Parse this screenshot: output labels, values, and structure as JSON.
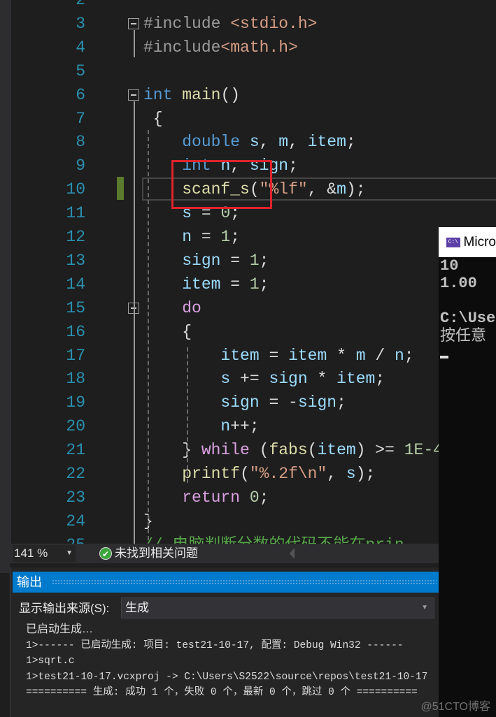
{
  "editor": {
    "lines": [
      {
        "n": "2",
        "tokens": []
      },
      {
        "n": "3",
        "tokens": [
          [
            "#include ",
            "pp"
          ],
          [
            "<stdio.h>",
            "str"
          ]
        ]
      },
      {
        "n": "4",
        "tokens": [
          [
            "#include",
            "pp"
          ],
          [
            "<math.h>",
            "str"
          ]
        ]
      },
      {
        "n": "5",
        "tokens": []
      },
      {
        "n": "6",
        "tokens": [
          [
            "int",
            "kw"
          ],
          [
            " ",
            "pl"
          ],
          [
            "main",
            "fn"
          ],
          [
            "()",
            "pl"
          ]
        ]
      },
      {
        "n": "7",
        "tokens": [
          [
            " {",
            "pl"
          ]
        ]
      },
      {
        "n": "8",
        "tokens": [
          [
            "    ",
            "pl"
          ],
          [
            "double",
            "kw"
          ],
          [
            " ",
            "pl"
          ],
          [
            "s",
            "var"
          ],
          [
            ", ",
            "pl"
          ],
          [
            "m",
            "var"
          ],
          [
            ", ",
            "pl"
          ],
          [
            "item",
            "var"
          ],
          [
            ";",
            "pl"
          ]
        ]
      },
      {
        "n": "9",
        "tokens": [
          [
            "    ",
            "pl"
          ],
          [
            "int",
            "kw"
          ],
          [
            " ",
            "pl"
          ],
          [
            "n",
            "var"
          ],
          [
            ", ",
            "pl"
          ],
          [
            "sign",
            "var"
          ],
          [
            ";",
            "pl"
          ]
        ]
      },
      {
        "n": "10",
        "tokens": [
          [
            "    ",
            "pl"
          ],
          [
            "scanf_s",
            "fn"
          ],
          [
            "(",
            "pl"
          ],
          [
            "\"%lf\"",
            "str"
          ],
          [
            ", &",
            "pl"
          ],
          [
            "m",
            "var"
          ],
          [
            ");",
            "pl"
          ]
        ]
      },
      {
        "n": "11",
        "tokens": [
          [
            "    ",
            "pl"
          ],
          [
            "s",
            "var"
          ],
          [
            " = ",
            "pl"
          ],
          [
            "0",
            "num"
          ],
          [
            ";",
            "pl"
          ]
        ]
      },
      {
        "n": "12",
        "tokens": [
          [
            "    ",
            "pl"
          ],
          [
            "n",
            "var"
          ],
          [
            " = ",
            "pl"
          ],
          [
            "1",
            "num"
          ],
          [
            ";",
            "pl"
          ]
        ]
      },
      {
        "n": "13",
        "tokens": [
          [
            "    ",
            "pl"
          ],
          [
            "sign",
            "var"
          ],
          [
            " = ",
            "pl"
          ],
          [
            "1",
            "num"
          ],
          [
            ";",
            "pl"
          ]
        ]
      },
      {
        "n": "14",
        "tokens": [
          [
            "    ",
            "pl"
          ],
          [
            "item",
            "var"
          ],
          [
            " = ",
            "pl"
          ],
          [
            "1",
            "num"
          ],
          [
            ";",
            "pl"
          ]
        ]
      },
      {
        "n": "15",
        "tokens": [
          [
            "    ",
            "pl"
          ],
          [
            "do",
            "ctl"
          ]
        ]
      },
      {
        "n": "16",
        "tokens": [
          [
            "    ",
            "pl"
          ],
          [
            "{",
            "pl"
          ]
        ]
      },
      {
        "n": "17",
        "tokens": [
          [
            "        ",
            "pl"
          ],
          [
            "item",
            "var"
          ],
          [
            " = ",
            "pl"
          ],
          [
            "item",
            "var"
          ],
          [
            " * ",
            "pl"
          ],
          [
            "m",
            "var"
          ],
          [
            " / ",
            "pl"
          ],
          [
            "n",
            "var"
          ],
          [
            ";",
            "pl"
          ]
        ]
      },
      {
        "n": "18",
        "tokens": [
          [
            "        ",
            "pl"
          ],
          [
            "s",
            "var"
          ],
          [
            " += ",
            "pl"
          ],
          [
            "sign",
            "var"
          ],
          [
            " * ",
            "pl"
          ],
          [
            "item",
            "var"
          ],
          [
            ";",
            "pl"
          ]
        ]
      },
      {
        "n": "19",
        "tokens": [
          [
            "        ",
            "pl"
          ],
          [
            "sign",
            "var"
          ],
          [
            " = -",
            "pl"
          ],
          [
            "sign",
            "var"
          ],
          [
            ";",
            "pl"
          ]
        ]
      },
      {
        "n": "20",
        "tokens": [
          [
            "        ",
            "pl"
          ],
          [
            "n",
            "var"
          ],
          [
            "++;",
            "pl"
          ]
        ]
      },
      {
        "n": "21",
        "tokens": [
          [
            "    ",
            "pl"
          ],
          [
            "} ",
            "pl"
          ],
          [
            "while",
            "ctl"
          ],
          [
            " (",
            "pl"
          ],
          [
            "fabs",
            "fn"
          ],
          [
            "(",
            "pl"
          ],
          [
            "item",
            "var"
          ],
          [
            ") >= ",
            "pl"
          ],
          [
            "1E-4",
            "num"
          ]
        ]
      },
      {
        "n": "22",
        "tokens": [
          [
            "    ",
            "pl"
          ],
          [
            "printf",
            "fn"
          ],
          [
            "(",
            "pl"
          ],
          [
            "\"%.2f",
            "str"
          ],
          [
            "\\n",
            "str"
          ],
          [
            "\"",
            "str"
          ],
          [
            ", ",
            "pl"
          ],
          [
            "s",
            "var"
          ],
          [
            ");",
            "pl"
          ]
        ]
      },
      {
        "n": "23",
        "tokens": [
          [
            "    ",
            "pl"
          ],
          [
            "return",
            "ctl"
          ],
          [
            " ",
            "pl"
          ],
          [
            "0",
            "num"
          ],
          [
            ";",
            "pl"
          ]
        ]
      },
      {
        "n": "24",
        "tokens": [
          [
            "}",
            "pl"
          ]
        ]
      },
      {
        "n": "25",
        "tokens": [
          [
            "// 电脑判断分数的代码不能在prin",
            "cm"
          ]
        ]
      }
    ]
  },
  "status": {
    "zoom": "141 %",
    "issues": "未找到相关问题"
  },
  "output": {
    "title": "输出",
    "source_label": "显示输出来源(S):",
    "source_value": "生成",
    "lines": [
      "已启动生成…",
      "1>------ 已启动生成: 项目: test21-10-17, 配置: Debug Win32 ------",
      "1>sqrt.c",
      "1>test21-10-17.vcxproj -> C:\\Users\\S2522\\source\\repos\\test21-10-17",
      "========== 生成: 成功 1 个，失败 0 个，最新 0 个，跳过 0 个 =========="
    ]
  },
  "console": {
    "title": "Micro",
    "icon_text": "C:\\",
    "lines": [
      "10",
      "1.00",
      "",
      "C:\\Use",
      "按任意"
    ]
  },
  "watermark": "@51CTO博客"
}
